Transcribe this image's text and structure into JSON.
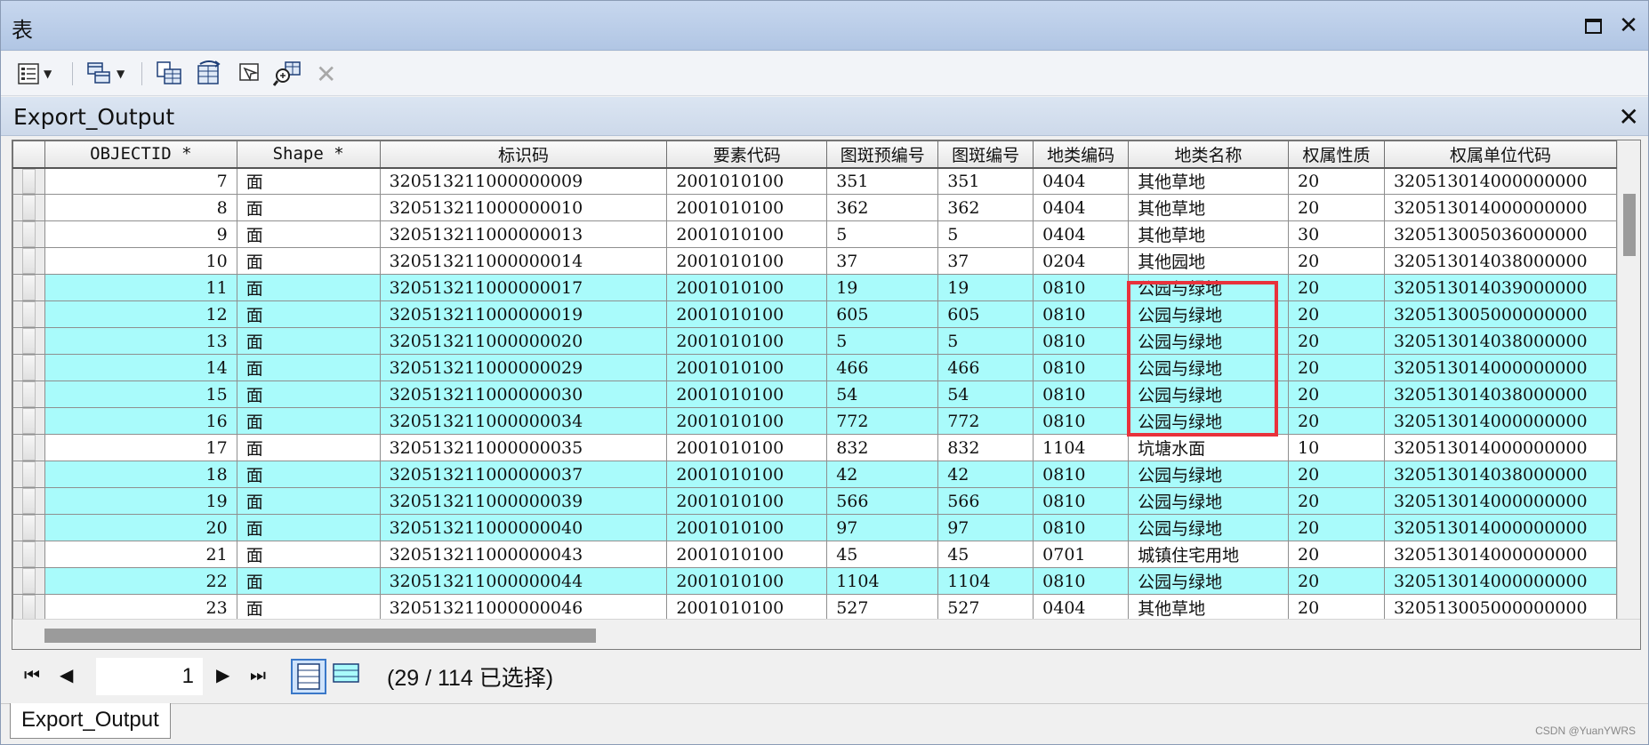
{
  "window": {
    "title": "表"
  },
  "toolbar": {
    "icons": [
      "table-options-icon",
      "related-tables-icon",
      "select-by-attributes-icon",
      "switch-selection-icon",
      "clear-selection-icon",
      "zoom-to-selected-icon",
      "delete-selected-icon"
    ]
  },
  "panel": {
    "name": "Export_Output"
  },
  "grid": {
    "columns": [
      "OBJECTID *",
      "Shape *",
      "标识码",
      "要素代码",
      "图斑预编号",
      "图斑编号",
      "地类编码",
      "地类名称",
      "权属性质",
      "权属单位代码"
    ],
    "rows": [
      {
        "selected": false,
        "cells": [
          "7",
          "面",
          "320513211000000009",
          "2001010100",
          "351",
          "351",
          "0404",
          "其他草地",
          "20",
          "320513014000000000"
        ]
      },
      {
        "selected": false,
        "cells": [
          "8",
          "面",
          "320513211000000010",
          "2001010100",
          "362",
          "362",
          "0404",
          "其他草地",
          "20",
          "320513014000000000"
        ]
      },
      {
        "selected": false,
        "cells": [
          "9",
          "面",
          "320513211000000013",
          "2001010100",
          "5",
          "5",
          "0404",
          "其他草地",
          "30",
          "320513005036000000"
        ]
      },
      {
        "selected": false,
        "cells": [
          "10",
          "面",
          "320513211000000014",
          "2001010100",
          "37",
          "37",
          "0204",
          "其他园地",
          "20",
          "320513014038000000"
        ]
      },
      {
        "selected": true,
        "cells": [
          "11",
          "面",
          "320513211000000017",
          "2001010100",
          "19",
          "19",
          "0810",
          "公园与绿地",
          "20",
          "320513014039000000"
        ]
      },
      {
        "selected": true,
        "cells": [
          "12",
          "面",
          "320513211000000019",
          "2001010100",
          "605",
          "605",
          "0810",
          "公园与绿地",
          "20",
          "320513005000000000"
        ]
      },
      {
        "selected": true,
        "cells": [
          "13",
          "面",
          "320513211000000020",
          "2001010100",
          "5",
          "5",
          "0810",
          "公园与绿地",
          "20",
          "320513014038000000"
        ]
      },
      {
        "selected": true,
        "cells": [
          "14",
          "面",
          "320513211000000029",
          "2001010100",
          "466",
          "466",
          "0810",
          "公园与绿地",
          "20",
          "320513014000000000"
        ]
      },
      {
        "selected": true,
        "cells": [
          "15",
          "面",
          "320513211000000030",
          "2001010100",
          "54",
          "54",
          "0810",
          "公园与绿地",
          "20",
          "320513014038000000"
        ]
      },
      {
        "selected": true,
        "cells": [
          "16",
          "面",
          "320513211000000034",
          "2001010100",
          "772",
          "772",
          "0810",
          "公园与绿地",
          "20",
          "320513014000000000"
        ]
      },
      {
        "selected": false,
        "cells": [
          "17",
          "面",
          "320513211000000035",
          "2001010100",
          "832",
          "832",
          "1104",
          "坑塘水面",
          "10",
          "320513014000000000"
        ]
      },
      {
        "selected": true,
        "cells": [
          "18",
          "面",
          "320513211000000037",
          "2001010100",
          "42",
          "42",
          "0810",
          "公园与绿地",
          "20",
          "320513014038000000"
        ]
      },
      {
        "selected": true,
        "cells": [
          "19",
          "面",
          "320513211000000039",
          "2001010100",
          "566",
          "566",
          "0810",
          "公园与绿地",
          "20",
          "320513014000000000"
        ]
      },
      {
        "selected": true,
        "cells": [
          "20",
          "面",
          "320513211000000040",
          "2001010100",
          "97",
          "97",
          "0810",
          "公园与绿地",
          "20",
          "320513014000000000"
        ]
      },
      {
        "selected": false,
        "cells": [
          "21",
          "面",
          "320513211000000043",
          "2001010100",
          "45",
          "45",
          "0701",
          "城镇住宅用地",
          "20",
          "320513014000000000"
        ]
      },
      {
        "selected": true,
        "cells": [
          "22",
          "面",
          "320513211000000044",
          "2001010100",
          "1104",
          "1104",
          "0810",
          "公园与绿地",
          "20",
          "320513014000000000"
        ]
      },
      {
        "selected": false,
        "cells": [
          "23",
          "面",
          "320513211000000046",
          "2001010100",
          "527",
          "527",
          "0404",
          "其他草地",
          "20",
          "320513005000000000"
        ]
      }
    ]
  },
  "nav": {
    "page": "1",
    "status": "(29 / 114 已选择)"
  },
  "tab": {
    "label": "Export_Output"
  },
  "watermark": "CSDN @YuanYWRS",
  "colors": {
    "selected_row": "#a9fbfb",
    "highlight": "#e8323c",
    "titlebar": "#b9cce8"
  }
}
